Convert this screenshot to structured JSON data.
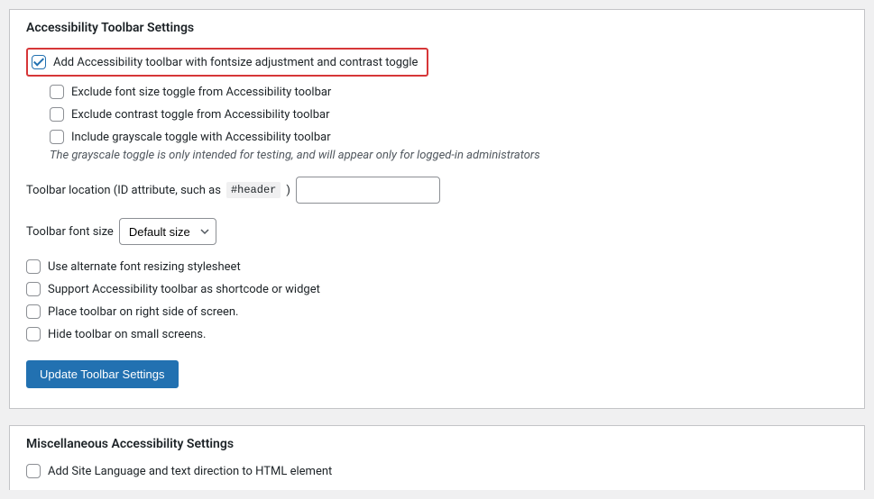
{
  "panel1": {
    "title": "Accessibility Toolbar Settings",
    "main_checkbox": "Add Accessibility toolbar with fontsize adjustment and contrast toggle",
    "sub": {
      "exclude_fontsize": "Exclude font size toggle from Accessibility toolbar",
      "exclude_contrast": "Exclude contrast toggle from Accessibility toolbar",
      "include_grayscale": "Include grayscale toggle with Accessibility toolbar"
    },
    "grayscale_note": "The grayscale toggle is only intended for testing, and will appear only for logged-in administrators",
    "location_label": "Toolbar location (ID attribute, such as",
    "location_code": "#header",
    "location_after": ")",
    "fontsize_label": "Toolbar font size",
    "fontsize_selected": "Default size",
    "opts": {
      "alt_resize": "Use alternate font resizing stylesheet",
      "shortcode": "Support Accessibility toolbar as shortcode or widget",
      "right_side": "Place toolbar on right side of screen.",
      "hide_small": "Hide toolbar on small screens."
    },
    "submit": "Update Toolbar Settings"
  },
  "panel2": {
    "title": "Miscellaneous Accessibility Settings",
    "lang_checkbox": "Add Site Language and text direction to HTML element"
  }
}
